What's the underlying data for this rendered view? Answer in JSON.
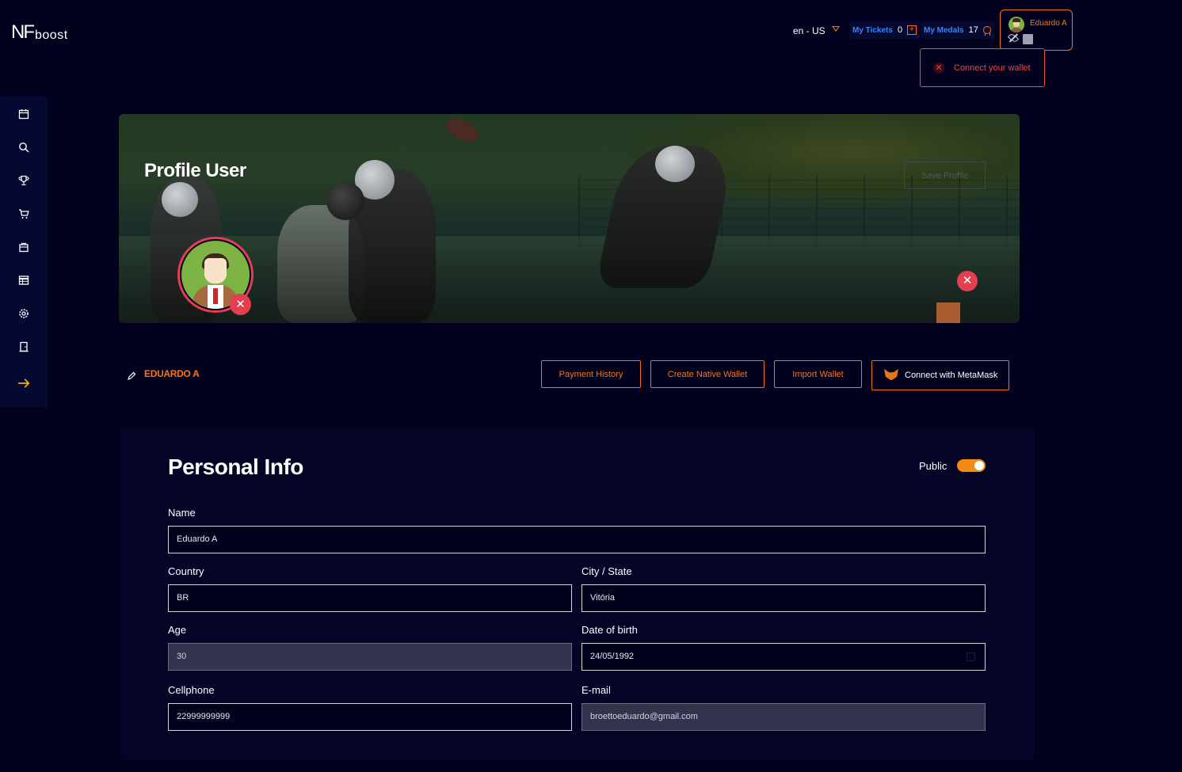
{
  "logo": {
    "nf": "NF",
    "boost": "boost"
  },
  "topbar": {
    "language": "en - US",
    "tickets_label": "My Tickets",
    "tickets_count": "0",
    "medals_label": "My Medals",
    "medals_count": "17",
    "user_name": "Eduardo A",
    "wallet_alert": "Connect your wallet"
  },
  "sidebar": {
    "items": [
      {
        "icon": "calendar-icon"
      },
      {
        "icon": "search-icon"
      },
      {
        "icon": "trophy-icon"
      },
      {
        "icon": "cart-icon"
      },
      {
        "icon": "bag-icon"
      },
      {
        "icon": "table-icon"
      },
      {
        "icon": "gear-icon"
      },
      {
        "icon": "door-icon"
      },
      {
        "icon": "arrow-right-icon"
      }
    ]
  },
  "banner": {
    "title": "Profile User",
    "save_label": "Save Profile"
  },
  "profile": {
    "username": "EDUARDO A",
    "buttons": {
      "payment_history": "Payment History",
      "create_native_wallet": "Create Native Wallet",
      "import_wallet": "Import Wallet",
      "connect_metamask": "Connect with MetaMask"
    }
  },
  "personal_info": {
    "title": "Personal Info",
    "public_label": "Public",
    "public_enabled": true,
    "fields": {
      "name": {
        "label": "Name",
        "value": "Eduardo A"
      },
      "country": {
        "label": "Country",
        "value": "BR"
      },
      "city": {
        "label": "City / State",
        "value": "Vitória"
      },
      "age": {
        "label": "Age",
        "value": "30"
      },
      "dob": {
        "label": "Date of birth",
        "value": "24/05/1992"
      },
      "cellphone": {
        "label": "Cellphone",
        "value": "22999999999"
      },
      "email": {
        "label": "E-mail",
        "value": "broettoeduardo@gmail.com"
      }
    }
  },
  "colors": {
    "background": "#02021f",
    "accent": "#f97316",
    "danger": "#e53e4f",
    "link": "#3b82f6"
  }
}
